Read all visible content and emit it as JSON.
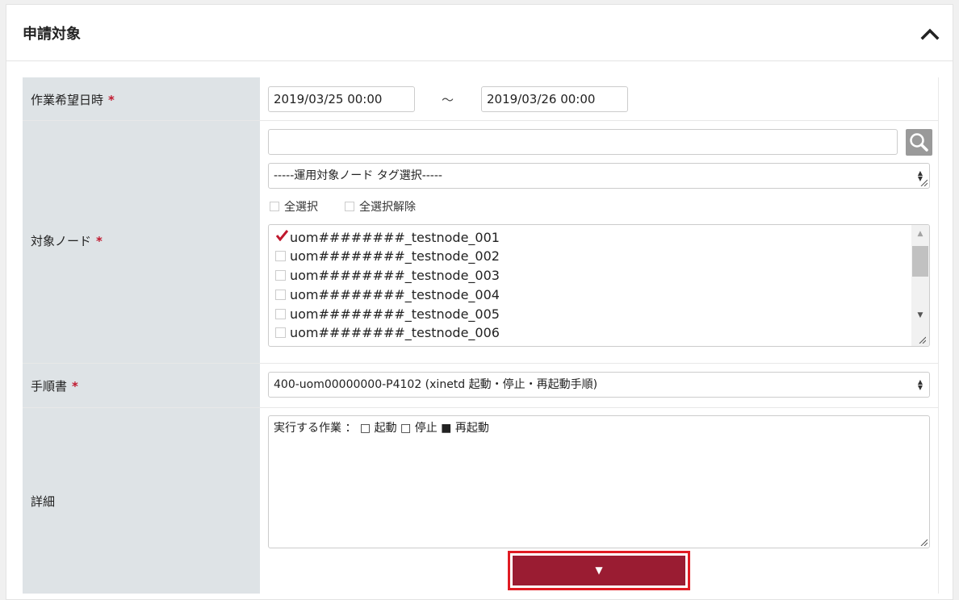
{
  "panel": {
    "title": "申請対象"
  },
  "fields": {
    "work_datetime": {
      "label": "作業希望日時",
      "required_mark": "*",
      "start": "2019/03/25 00:00",
      "separator": "～",
      "end": "2019/03/26 00:00"
    },
    "target_nodes": {
      "label": "対象ノード",
      "required_mark": "*",
      "search_value": "",
      "tag_select": "-----運用対象ノード タグ選択-----",
      "select_all": "全選択",
      "deselect_all": "全選択解除",
      "nodes": [
        {
          "name": "uom########_testnode_001",
          "checked": true
        },
        {
          "name": "uom########_testnode_002",
          "checked": false
        },
        {
          "name": "uom########_testnode_003",
          "checked": false
        },
        {
          "name": "uom########_testnode_004",
          "checked": false
        },
        {
          "name": "uom########_testnode_005",
          "checked": false
        },
        {
          "name": "uom########_testnode_006",
          "checked": false
        }
      ]
    },
    "procedure": {
      "label": "手順書",
      "required_mark": "*",
      "selected": "400-uom00000000-P4102 (xinetd 起動・停止・再起動手順)"
    },
    "details": {
      "label": "詳細",
      "text": "実行する作業 ： □ 起動 □ 停止 ■ 再起動",
      "expand_symbol": "▼"
    }
  },
  "colors": {
    "label_bg": "#dee3e6",
    "required": "#c0182e",
    "expand_button": "#9a1c32",
    "highlight": "#e01b23",
    "check": "#c0182e"
  }
}
